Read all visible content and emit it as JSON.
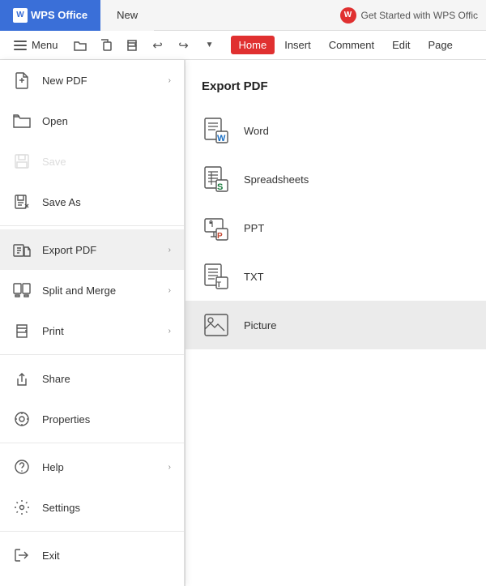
{
  "titlebar": {
    "wps_label": "WPS Office",
    "new_tab": "New",
    "get_started": "Get Started with WPS Offic"
  },
  "toolbar": {
    "menu_label": "Menu",
    "tabs": [
      "Home",
      "Insert",
      "Comment",
      "Edit",
      "Page"
    ]
  },
  "left_menu": {
    "items": [
      {
        "id": "new-pdf",
        "label": "New PDF",
        "has_arrow": true,
        "disabled": false
      },
      {
        "id": "open",
        "label": "Open",
        "has_arrow": false,
        "disabled": false
      },
      {
        "id": "save",
        "label": "Save",
        "has_arrow": false,
        "disabled": true
      },
      {
        "id": "save-as",
        "label": "Save As",
        "has_arrow": false,
        "disabled": false
      },
      {
        "id": "export-pdf",
        "label": "Export PDF",
        "has_arrow": true,
        "disabled": false,
        "active": true
      },
      {
        "id": "split-merge",
        "label": "Split and Merge",
        "has_arrow": true,
        "disabled": false
      },
      {
        "id": "print",
        "label": "Print",
        "has_arrow": true,
        "disabled": false
      },
      {
        "id": "share",
        "label": "Share",
        "has_arrow": false,
        "disabled": false
      },
      {
        "id": "properties",
        "label": "Properties",
        "has_arrow": false,
        "disabled": false
      },
      {
        "id": "help",
        "label": "Help",
        "has_arrow": true,
        "disabled": false
      },
      {
        "id": "settings",
        "label": "Settings",
        "has_arrow": false,
        "disabled": false
      },
      {
        "id": "exit",
        "label": "Exit",
        "has_arrow": false,
        "disabled": false
      }
    ]
  },
  "submenu": {
    "title": "Export PDF",
    "items": [
      {
        "id": "word",
        "label": "Word",
        "highlighted": false
      },
      {
        "id": "spreadsheets",
        "label": "Spreadsheets",
        "highlighted": false
      },
      {
        "id": "ppt",
        "label": "PPT",
        "highlighted": false
      },
      {
        "id": "txt",
        "label": "TXT",
        "highlighted": false
      },
      {
        "id": "picture",
        "label": "Picture",
        "highlighted": true
      }
    ]
  }
}
